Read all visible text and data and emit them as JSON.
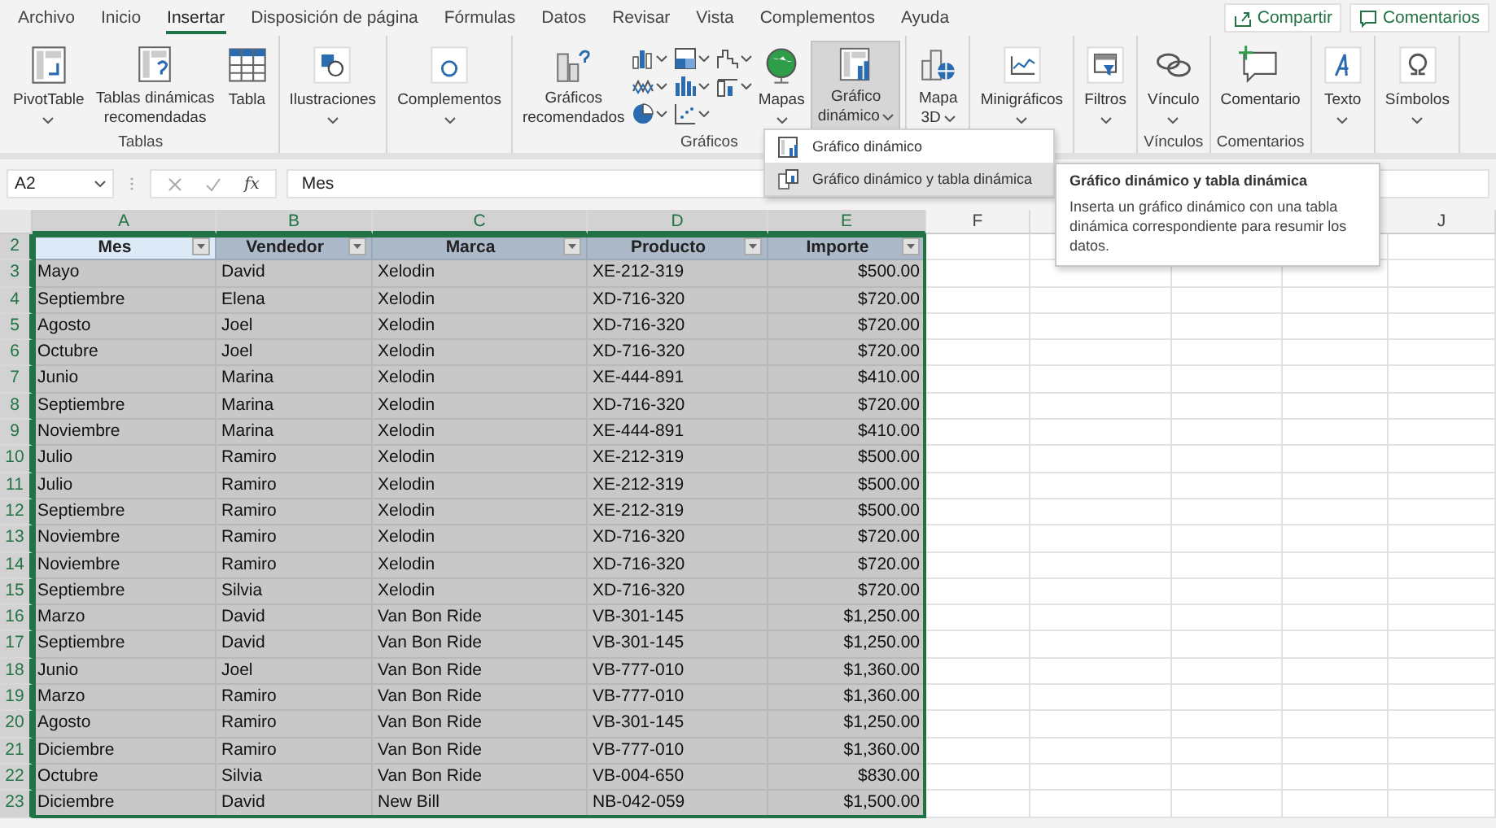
{
  "tabs": [
    {
      "label": "Archivo",
      "selected": false
    },
    {
      "label": "Inicio",
      "selected": false
    },
    {
      "label": "Insertar",
      "selected": true
    },
    {
      "label": "Disposición de página",
      "selected": false
    },
    {
      "label": "Fórmulas",
      "selected": false
    },
    {
      "label": "Datos",
      "selected": false
    },
    {
      "label": "Revisar",
      "selected": false
    },
    {
      "label": "Vista",
      "selected": false
    },
    {
      "label": "Complementos",
      "selected": false
    },
    {
      "label": "Ayuda",
      "selected": false
    }
  ],
  "share": {
    "share_label": "Compartir",
    "comments_label": "Comentarios"
  },
  "ribbon": {
    "groups": [
      {
        "label": "Tablas",
        "buttons": [
          {
            "kind": "large",
            "lines": [
              "PivotTable"
            ],
            "menu": true,
            "selected": false
          },
          {
            "kind": "large",
            "lines": [
              "Tablas dinámicas",
              "recomendadas"
            ],
            "menu": false,
            "selected": false
          },
          {
            "kind": "large",
            "lines": [
              "Tabla"
            ],
            "menu": false,
            "selected": false
          }
        ]
      },
      {
        "buttons": [
          {
            "kind": "large",
            "lines": [
              "Ilustraciones"
            ],
            "menu": true,
            "selected": false
          }
        ]
      },
      {
        "buttons": [
          {
            "kind": "large",
            "lines": [
              "Complementos"
            ],
            "menu": true,
            "selected": false
          }
        ]
      },
      {
        "label": "Gráficos",
        "buttons": [
          {
            "kind": "large",
            "lines": [
              "Gráficos",
              "recomendados"
            ],
            "menu": false,
            "selected": false
          },
          {
            "kind": "chart-types",
            "selected": false
          },
          {
            "kind": "large",
            "lines": [
              "Mapas"
            ],
            "menu": true,
            "selected": false
          },
          {
            "kind": "large",
            "lines": [
              "Gráfico",
              "dinámico"
            ],
            "menu": true,
            "selected": true
          }
        ]
      },
      {
        "buttons": [
          {
            "kind": "large",
            "lines": [
              "Mapa",
              "3D"
            ],
            "menu": true,
            "selected": false
          }
        ]
      },
      {
        "buttons": [
          {
            "kind": "large",
            "lines": [
              "Minigráficos"
            ],
            "menu": true,
            "selected": false
          }
        ]
      },
      {
        "buttons": [
          {
            "kind": "large",
            "lines": [
              "Filtros"
            ],
            "menu": true,
            "selected": false
          }
        ]
      },
      {
        "label": "Vínculos",
        "buttons": [
          {
            "kind": "large",
            "lines": [
              "Vínculo"
            ],
            "menu": true,
            "selected": false
          }
        ]
      },
      {
        "label": "Comentarios",
        "buttons": [
          {
            "kind": "large",
            "lines": [
              "Comentario"
            ],
            "menu": false,
            "selected": false
          }
        ]
      },
      {
        "buttons": [
          {
            "kind": "large",
            "lines": [
              "Texto"
            ],
            "menu": true,
            "selected": false
          }
        ]
      },
      {
        "buttons": [
          {
            "kind": "large",
            "lines": [
              "Símbolos"
            ],
            "menu": true,
            "selected": false
          }
        ]
      }
    ]
  },
  "formula_bar": {
    "name_box": "A2",
    "function_label": "fx",
    "value": "Mes"
  },
  "menu": {
    "items": [
      {
        "label": "Gráfico dinámico",
        "selected": false
      },
      {
        "label": "Gráfico dinámico y tabla dinámica",
        "selected": true
      }
    ]
  },
  "tooltip": {
    "title": "Gráfico dinámico y tabla dinámica",
    "body": "Inserta un gráfico dinámico con una tabla dinámica correspondiente para resumir los datos."
  },
  "table": {
    "columns": [
      {
        "label": "A",
        "selected": true
      },
      {
        "label": "B",
        "selected": true
      },
      {
        "label": "C",
        "selected": true
      },
      {
        "label": "D",
        "selected": true
      },
      {
        "label": "E",
        "selected": true
      },
      {
        "label": "F",
        "selected": false
      },
      {
        "label": "J",
        "selected": false
      }
    ],
    "header": {
      "number": "2",
      "selected": true,
      "cells": [
        {
          "text": "Mes",
          "active": true
        },
        {
          "text": "Vendedor",
          "active": false
        },
        {
          "text": "Marca",
          "active": false
        },
        {
          "text": "Producto",
          "active": false
        },
        {
          "text": "Importe",
          "active": false
        }
      ]
    },
    "rows": [
      {
        "number": "3",
        "selected": true,
        "cells": [
          "Mayo",
          "David",
          "Xelodin",
          "XE-212-319",
          "$500.00"
        ]
      },
      {
        "number": "4",
        "selected": true,
        "cells": [
          "Septiembre",
          "Elena",
          "Xelodin",
          "XD-716-320",
          "$720.00"
        ]
      },
      {
        "number": "5",
        "selected": true,
        "cells": [
          "Agosto",
          "Joel",
          "Xelodin",
          "XD-716-320",
          "$720.00"
        ]
      },
      {
        "number": "6",
        "selected": true,
        "cells": [
          "Octubre",
          "Joel",
          "Xelodin",
          "XD-716-320",
          "$720.00"
        ]
      },
      {
        "number": "7",
        "selected": true,
        "cells": [
          "Junio",
          "Marina",
          "Xelodin",
          "XE-444-891",
          "$410.00"
        ]
      },
      {
        "number": "8",
        "selected": true,
        "cells": [
          "Septiembre",
          "Marina",
          "Xelodin",
          "XD-716-320",
          "$720.00"
        ]
      },
      {
        "number": "9",
        "selected": true,
        "cells": [
          "Noviembre",
          "Marina",
          "Xelodin",
          "XE-444-891",
          "$410.00"
        ]
      },
      {
        "number": "10",
        "selected": true,
        "cells": [
          "Julio",
          "Ramiro",
          "Xelodin",
          "XE-212-319",
          "$500.00"
        ]
      },
      {
        "number": "11",
        "selected": true,
        "cells": [
          "Julio",
          "Ramiro",
          "Xelodin",
          "XE-212-319",
          "$500.00"
        ]
      },
      {
        "number": "12",
        "selected": true,
        "cells": [
          "Septiembre",
          "Ramiro",
          "Xelodin",
          "XE-212-319",
          "$500.00"
        ]
      },
      {
        "number": "13",
        "selected": true,
        "cells": [
          "Noviembre",
          "Ramiro",
          "Xelodin",
          "XD-716-320",
          "$720.00"
        ]
      },
      {
        "number": "14",
        "selected": true,
        "cells": [
          "Noviembre",
          "Ramiro",
          "Xelodin",
          "XD-716-320",
          "$720.00"
        ]
      },
      {
        "number": "15",
        "selected": true,
        "cells": [
          "Septiembre",
          "Silvia",
          "Xelodin",
          "XD-716-320",
          "$720.00"
        ]
      },
      {
        "number": "16",
        "selected": true,
        "cells": [
          "Marzo",
          "David",
          "Van Bon Ride",
          "VB-301-145",
          "$1,250.00"
        ]
      },
      {
        "number": "17",
        "selected": true,
        "cells": [
          "Septiembre",
          "David",
          "Van Bon Ride",
          "VB-301-145",
          "$1,250.00"
        ]
      },
      {
        "number": "18",
        "selected": true,
        "cells": [
          "Junio",
          "Joel",
          "Van Bon Ride",
          "VB-777-010",
          "$1,360.00"
        ]
      },
      {
        "number": "19",
        "selected": true,
        "cells": [
          "Marzo",
          "Ramiro",
          "Van Bon Ride",
          "VB-777-010",
          "$1,360.00"
        ]
      },
      {
        "number": "20",
        "selected": true,
        "cells": [
          "Agosto",
          "Ramiro",
          "Van Bon Ride",
          "VB-301-145",
          "$1,250.00"
        ]
      },
      {
        "number": "21",
        "selected": true,
        "cells": [
          "Diciembre",
          "Ramiro",
          "Van Bon Ride",
          "VB-777-010",
          "$1,360.00"
        ]
      },
      {
        "number": "22",
        "selected": true,
        "cells": [
          "Octubre",
          "Silvia",
          "Van Bon Ride",
          "VB-004-650",
          "$830.00"
        ]
      },
      {
        "number": "23",
        "selected": true,
        "cells": [
          "Diciembre",
          "David",
          "New Bill",
          "NB-042-059",
          "$1,500.00"
        ]
      }
    ]
  }
}
